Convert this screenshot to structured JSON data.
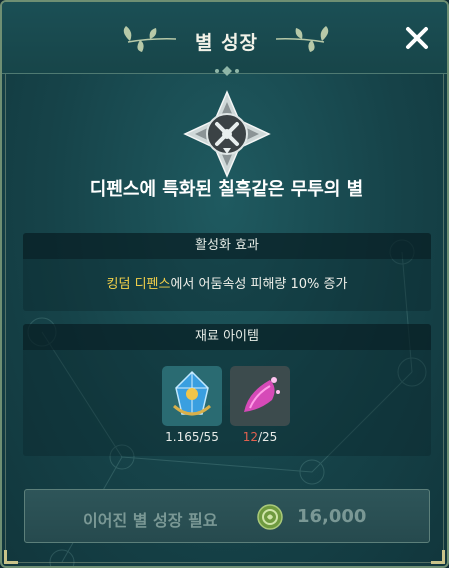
{
  "header": {
    "title": "별 성장"
  },
  "star": {
    "name": "디펜스에 특화된 칠흑같은 무투의 별"
  },
  "effect_section": {
    "heading": "활성화 효과",
    "highlight": "킹덤 디펜스",
    "rest": "에서 어둠속성 피해량 10% 증가"
  },
  "materials_section": {
    "heading": "재료 아이템",
    "items": [
      {
        "icon": "blue-crystal-icon",
        "current": "1.165",
        "required": "/55"
      },
      {
        "icon": "pink-star-fragment-icon",
        "current": "12",
        "required": "/25"
      }
    ]
  },
  "action_button": {
    "label": "이어진 별 성장 필요",
    "cost": "16,000",
    "icon": "coin-icon"
  },
  "colors": {
    "highlight": "#f3d04a",
    "insufficient": "#e0604f",
    "panel": "#164349",
    "border": "#6f8f73"
  }
}
